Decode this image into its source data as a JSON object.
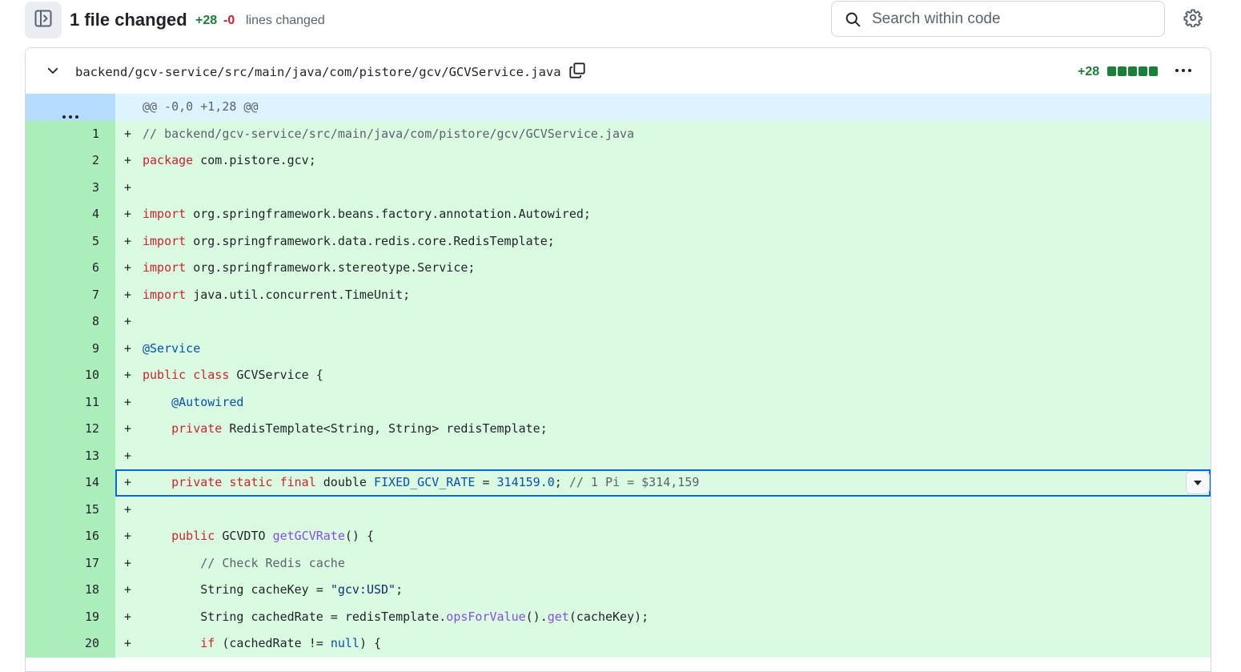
{
  "toolbar": {
    "files_changed": "1 file changed",
    "additions": "+28",
    "deletions": "-0",
    "lines_changed": "lines changed",
    "search_placeholder": "Search within code"
  },
  "file": {
    "path": "backend/gcv-service/src/main/java/com/pistore/gcv/GCVService.java",
    "additions": "+28",
    "diffstat_blocks": 5
  },
  "hunk_header": "@@ -0,0 +1,28 @@",
  "colors": {
    "added_gutter": "#aceebb",
    "added_code": "#dafbe1",
    "hunk_gutter": "#b6dcfe",
    "hunk_code": "#ddf4ff",
    "keyword": "#cf222e",
    "comment": "#59636e",
    "annotation": "#0550ae",
    "function": "#8250df",
    "string": "#0a3069",
    "selection": "#0969da",
    "addition": "#1a7f37"
  },
  "lines": [
    {
      "num": "1",
      "marker": "+",
      "tokens": [
        {
          "t": "// backend/gcv-service/src/main/java/com/pistore/gcv/GCVService.java",
          "c": "comment"
        }
      ]
    },
    {
      "num": "2",
      "marker": "+",
      "tokens": [
        {
          "t": "package",
          "c": "keyword"
        },
        {
          "t": " com.pistore.gcv;",
          "c": ""
        }
      ]
    },
    {
      "num": "3",
      "marker": "+",
      "tokens": []
    },
    {
      "num": "4",
      "marker": "+",
      "tokens": [
        {
          "t": "import",
          "c": "keyword"
        },
        {
          "t": " org.springframework.beans.factory.annotation.Autowired;",
          "c": ""
        }
      ]
    },
    {
      "num": "5",
      "marker": "+",
      "tokens": [
        {
          "t": "import",
          "c": "keyword"
        },
        {
          "t": " org.springframework.data.redis.core.RedisTemplate;",
          "c": ""
        }
      ]
    },
    {
      "num": "6",
      "marker": "+",
      "tokens": [
        {
          "t": "import",
          "c": "keyword"
        },
        {
          "t": " org.springframework.stereotype.Service;",
          "c": ""
        }
      ]
    },
    {
      "num": "7",
      "marker": "+",
      "tokens": [
        {
          "t": "import",
          "c": "keyword"
        },
        {
          "t": " java.util.concurrent.TimeUnit;",
          "c": ""
        }
      ]
    },
    {
      "num": "8",
      "marker": "+",
      "tokens": []
    },
    {
      "num": "9",
      "marker": "+",
      "tokens": [
        {
          "t": "@Service",
          "c": "annotation"
        }
      ]
    },
    {
      "num": "10",
      "marker": "+",
      "tokens": [
        {
          "t": "public",
          "c": "keyword"
        },
        {
          "t": " ",
          "c": ""
        },
        {
          "t": "class",
          "c": "keyword"
        },
        {
          "t": " GCVService {",
          "c": ""
        }
      ]
    },
    {
      "num": "11",
      "marker": "+",
      "tokens": [
        {
          "t": "    ",
          "c": ""
        },
        {
          "t": "@Autowired",
          "c": "annotation"
        }
      ]
    },
    {
      "num": "12",
      "marker": "+",
      "tokens": [
        {
          "t": "    ",
          "c": ""
        },
        {
          "t": "private",
          "c": "keyword"
        },
        {
          "t": " RedisTemplate<String, String> redisTemplate;",
          "c": ""
        }
      ]
    },
    {
      "num": "13",
      "marker": "+",
      "tokens": []
    },
    {
      "num": "14",
      "marker": "+",
      "selected": true,
      "tokens": [
        {
          "t": "    ",
          "c": ""
        },
        {
          "t": "private",
          "c": "keyword"
        },
        {
          "t": " ",
          "c": ""
        },
        {
          "t": "static",
          "c": "keyword"
        },
        {
          "t": " ",
          "c": ""
        },
        {
          "t": "final",
          "c": "keyword"
        },
        {
          "t": " double ",
          "c": ""
        },
        {
          "t": "FIXED_GCV_RATE",
          "c": "constant"
        },
        {
          "t": " = ",
          "c": ""
        },
        {
          "t": "314159.0",
          "c": "constant"
        },
        {
          "t": "; ",
          "c": ""
        },
        {
          "t": "// 1 Pi = $314,159",
          "c": "comment"
        }
      ]
    },
    {
      "num": "15",
      "marker": "+",
      "tokens": []
    },
    {
      "num": "16",
      "marker": "+",
      "tokens": [
        {
          "t": "    ",
          "c": ""
        },
        {
          "t": "public",
          "c": "keyword"
        },
        {
          "t": " GCVDTO ",
          "c": ""
        },
        {
          "t": "getGCVRate",
          "c": "function"
        },
        {
          "t": "() {",
          "c": ""
        }
      ]
    },
    {
      "num": "17",
      "marker": "+",
      "tokens": [
        {
          "t": "        ",
          "c": ""
        },
        {
          "t": "// Check Redis cache",
          "c": "comment"
        }
      ]
    },
    {
      "num": "18",
      "marker": "+",
      "tokens": [
        {
          "t": "        String cacheKey = ",
          "c": ""
        },
        {
          "t": "\"gcv:USD\"",
          "c": "string"
        },
        {
          "t": ";",
          "c": ""
        }
      ]
    },
    {
      "num": "19",
      "marker": "+",
      "tokens": [
        {
          "t": "        String cachedRate = redisTemplate.",
          "c": ""
        },
        {
          "t": "opsForValue",
          "c": "function"
        },
        {
          "t": "().",
          "c": ""
        },
        {
          "t": "get",
          "c": "function"
        },
        {
          "t": "(cacheKey);",
          "c": ""
        }
      ]
    },
    {
      "num": "20",
      "marker": "+",
      "tokens": [
        {
          "t": "        ",
          "c": ""
        },
        {
          "t": "if",
          "c": "keyword"
        },
        {
          "t": " (cachedRate != ",
          "c": ""
        },
        {
          "t": "null",
          "c": "constant"
        },
        {
          "t": ") {",
          "c": ""
        }
      ]
    }
  ]
}
